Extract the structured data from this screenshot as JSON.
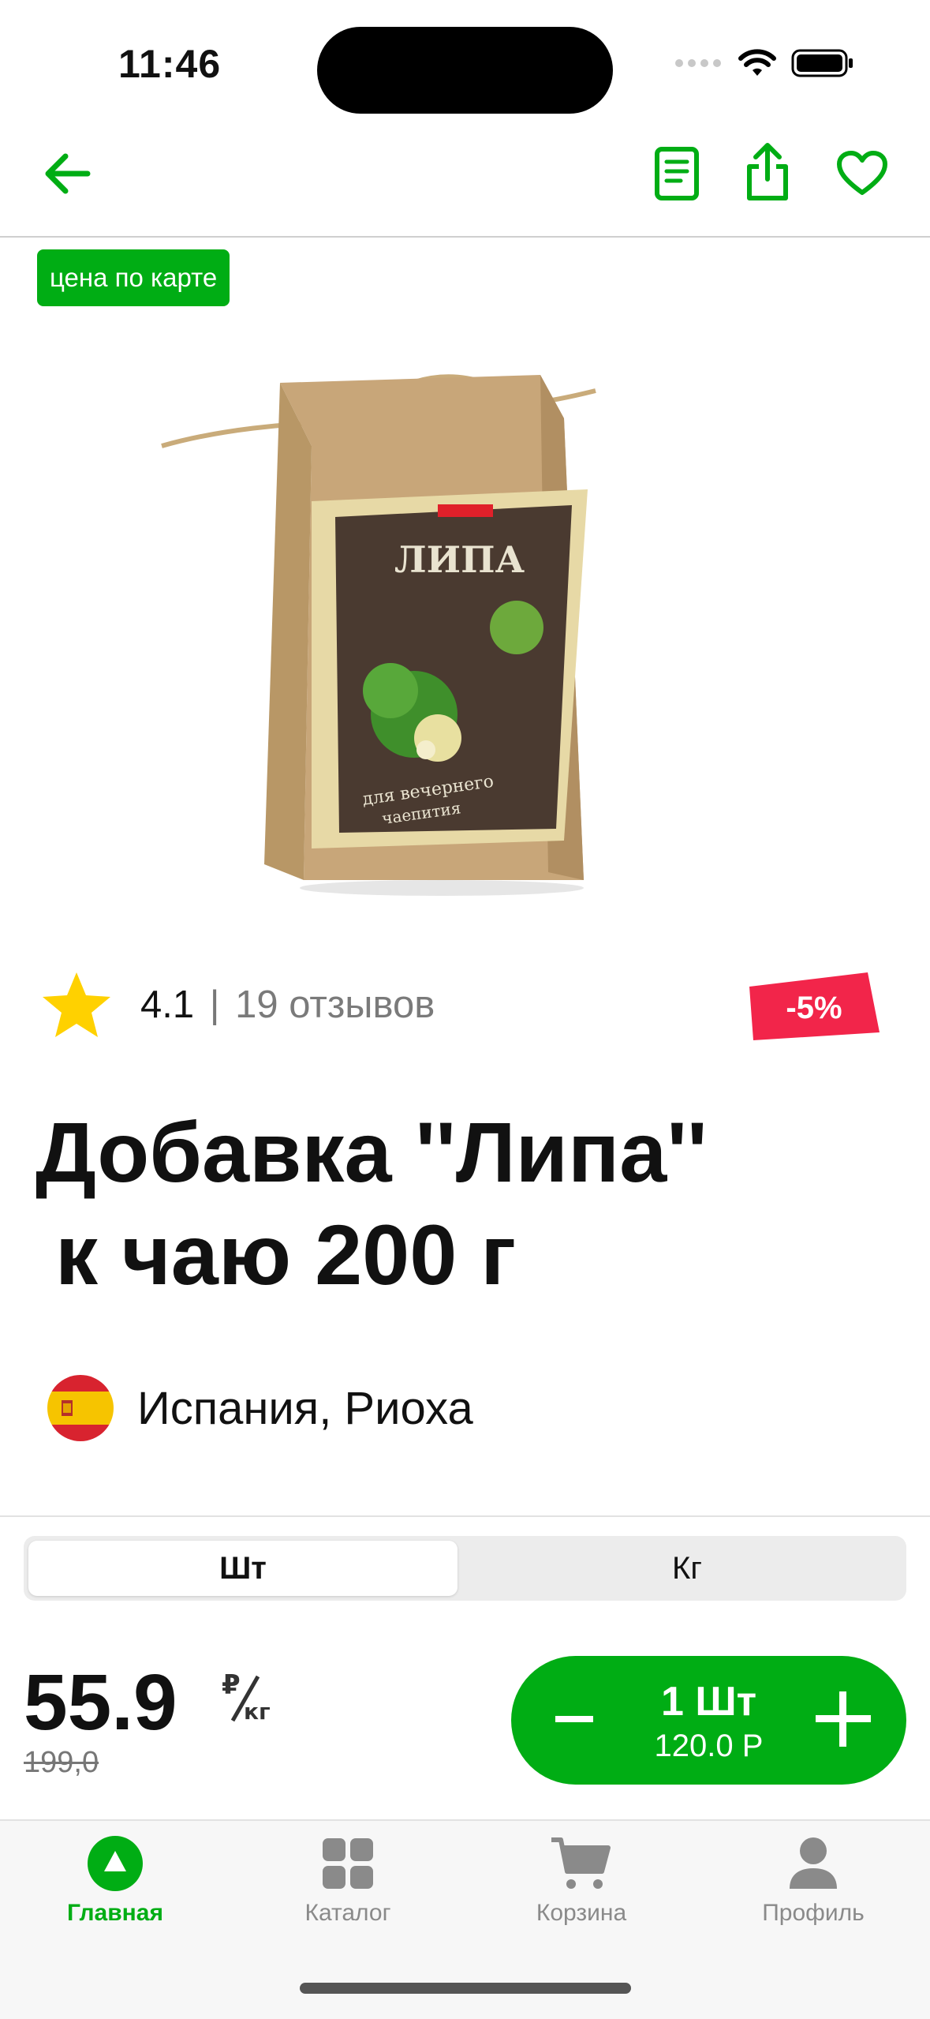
{
  "status_bar": {
    "time": "11:46"
  },
  "badge": {
    "card_price": "цена по карте"
  },
  "product": {
    "image_alt": "Липа — для вечернего чаепития"
  },
  "rating": {
    "value": "4.1",
    "separator": "|",
    "reviews": "19 отзывов",
    "stars": 4.1
  },
  "discount": {
    "label": "-5%"
  },
  "title": {
    "line1": "Добавка ''Липа''",
    "line2": "к чаю 200 г"
  },
  "origin": {
    "country": "Испания, Риоха"
  },
  "units": {
    "options": [
      "Шт",
      "Кг"
    ],
    "selected": "Шт"
  },
  "price": {
    "current": "55.9",
    "unit_symbol": "₽/кг",
    "old": "199,0"
  },
  "cart_stepper": {
    "quantity": "1 Шт",
    "sum": "120.0 Р",
    "minus": "-",
    "plus": "+"
  },
  "tabbar": {
    "items": [
      {
        "label": "Главная",
        "icon": "home-icon",
        "active": true
      },
      {
        "label": "Каталог",
        "icon": "catalog-icon",
        "active": false
      },
      {
        "label": "Корзина",
        "icon": "cart-icon",
        "active": false
      },
      {
        "label": "Профиль",
        "icon": "profile-icon",
        "active": false
      }
    ]
  },
  "colors": {
    "accent": "#00ad14",
    "discount": "#f2254a",
    "star": "#ffd100"
  }
}
